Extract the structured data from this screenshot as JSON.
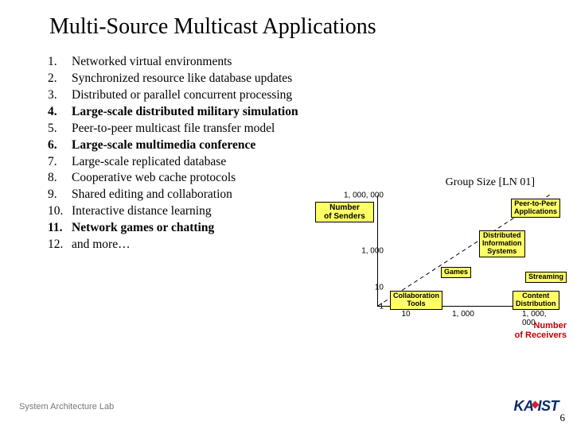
{
  "title": "Multi-Source Multicast Applications",
  "list": [
    {
      "num": "1.",
      "text": "Networked virtual environments",
      "bold": false
    },
    {
      "num": "2.",
      "text": "Synchronized resource like database updates",
      "bold": false
    },
    {
      "num": "3.",
      "text": "Distributed or parallel concurrent processing",
      "bold": false
    },
    {
      "num": "4.",
      "text": "Large-scale distributed military simulation",
      "bold": true
    },
    {
      "num": "5.",
      "text": "Peer-to-peer multicast file transfer model",
      "bold": false
    },
    {
      "num": "6.",
      "text": "Large-scale multimedia conference",
      "bold": true
    },
    {
      "num": "7.",
      "text": "Large-scale replicated database",
      "bold": false
    },
    {
      "num": "8.",
      "text": "Cooperative web cache protocols",
      "bold": false
    },
    {
      "num": "9.",
      "text": "Shared editing and collaboration",
      "bold": false
    },
    {
      "num": "10.",
      "text": "Interactive distance learning",
      "bold": false
    },
    {
      "num": "11.",
      "text": "Network games or chatting",
      "bold": true
    },
    {
      "num": "12.",
      "text": "and more…",
      "bold": false
    }
  ],
  "chart_data": {
    "type": "scatter",
    "title": "Group Size [LN 01]",
    "xlabel": "Number of Receivers",
    "ylabel": "Number of Senders",
    "x_scale": "log",
    "y_scale": "log",
    "xlim": [
      1,
      1000000
    ],
    "ylim": [
      1,
      1000000
    ],
    "x_ticks": [
      10,
      1000,
      1000000
    ],
    "x_tick_labels": [
      "10",
      "1, 000",
      "1, 000, 000"
    ],
    "y_ticks": [
      1,
      10,
      1000,
      1000000
    ],
    "y_tick_labels": [
      "1",
      "10",
      "1, 000",
      "1, 000, 000"
    ],
    "diagonal_line": {
      "from": [
        1,
        1
      ],
      "to": [
        1000000,
        1000000
      ],
      "style": "dashed"
    },
    "regions": [
      {
        "name": "Peer-to-Peer Applications",
        "x_range": [
          100000,
          1000000
        ],
        "y_range": [
          100000,
          1000000
        ]
      },
      {
        "name": "Distributed Information Systems",
        "x_range": [
          1000,
          100000
        ],
        "y_range": [
          300,
          30000
        ]
      },
      {
        "name": "Games",
        "x_range": [
          100,
          3000
        ],
        "y_range": [
          10,
          300
        ]
      },
      {
        "name": "Streaming",
        "x_range": [
          100000,
          1000000
        ],
        "y_range": [
          5,
          50
        ]
      },
      {
        "name": "Collaboration Tools",
        "x_range": [
          3,
          30
        ],
        "y_range": [
          1,
          5
        ]
      },
      {
        "name": "Content Distribution",
        "x_range": [
          100000,
          1000000
        ],
        "y_range": [
          1,
          3
        ]
      }
    ]
  },
  "footer": "System Architecture Lab",
  "page_num": "6",
  "logo": "KAIST"
}
